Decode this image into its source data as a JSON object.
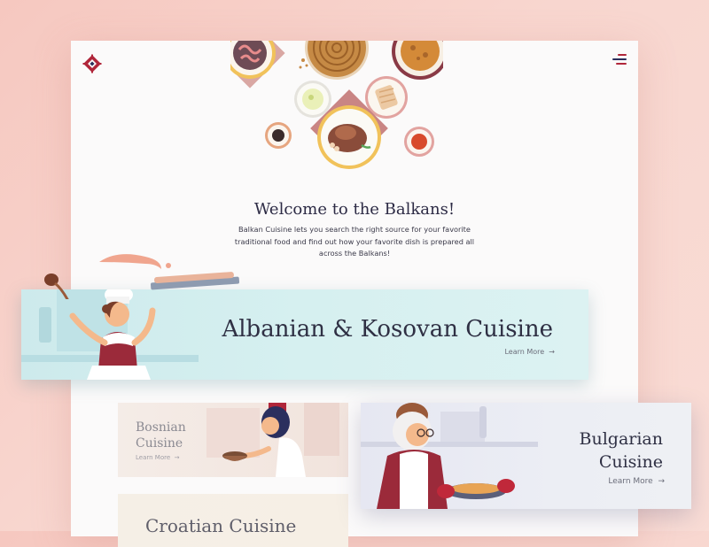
{
  "header": {
    "logo_icon": "balkan-diamond-logo-icon",
    "menu_icon": "hamburger-menu-icon"
  },
  "colors": {
    "accent": "#b0263a",
    "dark": "#2d2b45",
    "teal_card": "#d2eeee",
    "lavender_card": "#e8e9f3",
    "peach_card": "#f3e8e2",
    "cream_card": "#f5efe6"
  },
  "hero": {
    "title": "Welcome to the Balkans!",
    "text": "Balkan Cuisine lets you search the right source for your favorite traditional food and find out how your favorite dish is prepared all across the Balkans!"
  },
  "cuisines": {
    "albanian": {
      "title": "Albanian & Kosovan Cuisine",
      "link": "Learn More"
    },
    "bosnian": {
      "title_line1": "Bosnian",
      "title_line2": "Cuisine",
      "link": "Learn More"
    },
    "bulgarian": {
      "title_line1": "Bulgarian",
      "title_line2": "Cuisine",
      "link": "Learn More"
    },
    "croatian": {
      "title": "Croatian Cuisine"
    }
  },
  "icons": {
    "arrow": "arrow-right-icon"
  }
}
